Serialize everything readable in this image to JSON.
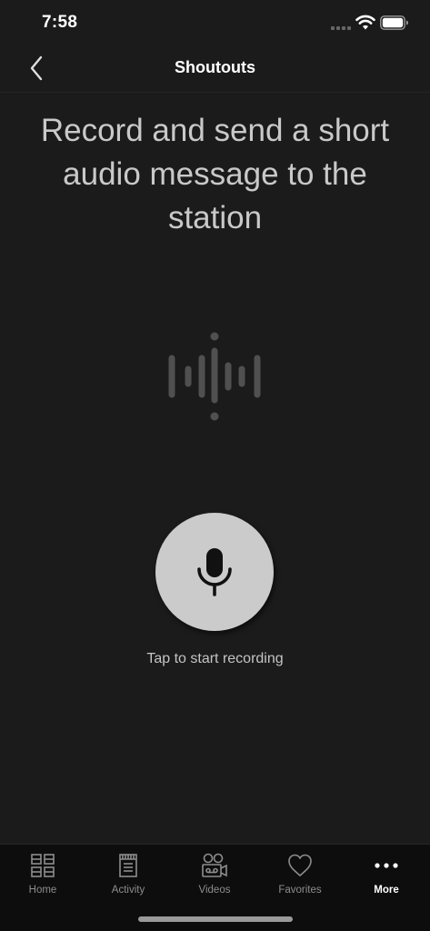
{
  "status_bar": {
    "time": "7:58"
  },
  "header": {
    "title": "Shoutouts",
    "back_icon": "chevron-left-icon"
  },
  "main": {
    "headline": "Record and send a short audio message to the station",
    "record_hint": "Tap to start recording",
    "record_icon": "microphone-icon",
    "waveform_icon": "audio-waveform-icon"
  },
  "tab_bar": {
    "tabs": [
      {
        "label": "Home",
        "icon": "grid-icon",
        "active": false
      },
      {
        "label": "Activity",
        "icon": "document-icon",
        "active": false
      },
      {
        "label": "Videos",
        "icon": "video-camera-icon",
        "active": false
      },
      {
        "label": "Favorites",
        "icon": "heart-icon",
        "active": false
      },
      {
        "label": "More",
        "icon": "more-dots-icon",
        "active": true
      }
    ]
  },
  "colors": {
    "background": "#1b1b1b",
    "tab_bar_background": "#0d0d0d",
    "headline_text": "#c9c9c9",
    "record_button": "#cbcbcb",
    "inactive_tab": "#8d8d8d",
    "active_tab": "#ffffff",
    "waveform": "#505050"
  }
}
